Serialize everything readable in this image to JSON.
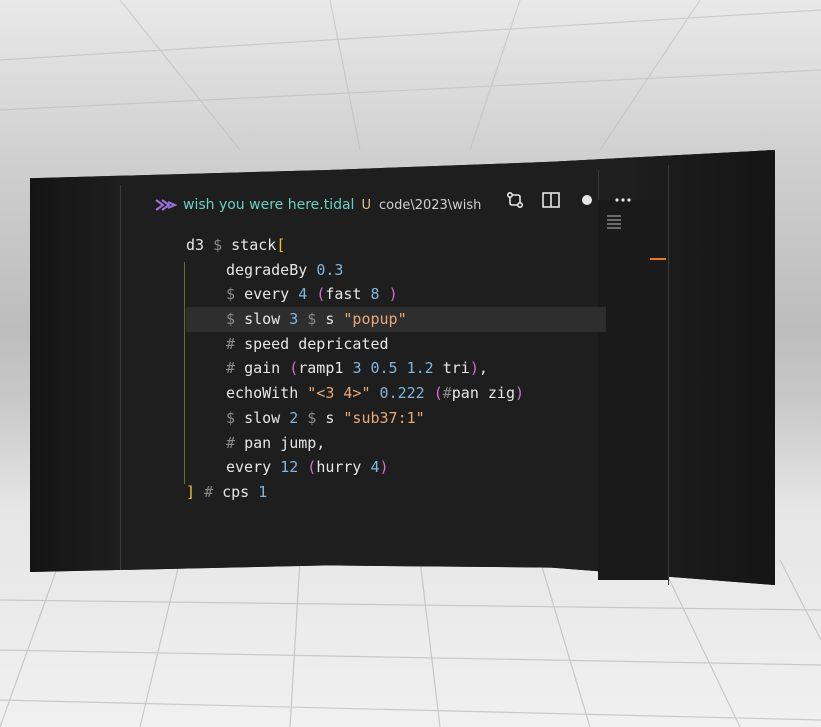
{
  "editor": {
    "tab": {
      "filename": "wish you were here.tidal",
      "status": "U",
      "path": "code\\2023\\wish",
      "icon": "tidal-file-icon"
    },
    "actions": [
      "source-control-icon",
      "split-editor-icon",
      "dot-icon",
      "more-icon"
    ],
    "code_lines": [
      {
        "parts": [
          [
            "kw",
            "d3 "
          ],
          [
            "op",
            "$ "
          ],
          [
            "kw",
            "stack"
          ],
          [
            "br1",
            "["
          ]
        ]
      },
      {
        "parts": [
          [
            "ind",
            ""
          ],
          [
            "kw",
            "degradeBy "
          ],
          [
            "num",
            "0.3"
          ]
        ]
      },
      {
        "parts": [
          [
            "ind",
            ""
          ],
          [
            "op",
            "$ "
          ],
          [
            "kw",
            "every "
          ],
          [
            "num",
            "4 "
          ],
          [
            "br2",
            "("
          ],
          [
            "kw",
            "fast "
          ],
          [
            "num",
            "8 "
          ],
          [
            "br2",
            ")"
          ]
        ]
      },
      {
        "parts": [
          [
            "ind",
            ""
          ],
          [
            "op",
            "$ "
          ],
          [
            "kw",
            "slow "
          ],
          [
            "num",
            "3 "
          ],
          [
            "op",
            "$ "
          ],
          [
            "kw",
            "s "
          ],
          [
            "str",
            "\"popup\""
          ]
        ],
        "highlight": true
      },
      {
        "parts": [
          [
            "ind",
            ""
          ],
          [
            "op",
            "# "
          ],
          [
            "kw",
            "speed depricated"
          ]
        ]
      },
      {
        "parts": [
          [
            "ind",
            ""
          ],
          [
            "op",
            "# "
          ],
          [
            "kw",
            "gain "
          ],
          [
            "br2",
            "("
          ],
          [
            "kw",
            "ramp1 "
          ],
          [
            "num",
            "3 0.5 1.2 "
          ],
          [
            "kw",
            "tri"
          ],
          [
            "br2",
            ")"
          ],
          [
            "kw",
            ","
          ]
        ]
      },
      {
        "parts": [
          [
            "ind",
            ""
          ],
          [
            "kw",
            "echoWith "
          ],
          [
            "str",
            "\"<3 4>\" "
          ],
          [
            "num",
            "0.222 "
          ],
          [
            "br2",
            "("
          ],
          [
            "op",
            "#"
          ],
          [
            "kw",
            "pan zig"
          ],
          [
            "br2",
            ")"
          ]
        ]
      },
      {
        "parts": [
          [
            "ind",
            ""
          ],
          [
            "op",
            "$ "
          ],
          [
            "kw",
            "slow "
          ],
          [
            "num",
            "2 "
          ],
          [
            "op",
            "$ "
          ],
          [
            "kw",
            "s "
          ],
          [
            "str",
            "\"sub37:1\""
          ]
        ]
      },
      {
        "parts": [
          [
            "ind",
            ""
          ],
          [
            "op",
            "# "
          ],
          [
            "kw",
            "pan jump,"
          ]
        ]
      },
      {
        "parts": [
          [
            "ind",
            ""
          ],
          [
            "kw",
            "every "
          ],
          [
            "num",
            "12 "
          ],
          [
            "br2",
            "("
          ],
          [
            "kw",
            "hurry "
          ],
          [
            "num",
            "4"
          ],
          [
            "br2",
            ")"
          ]
        ]
      },
      {
        "parts": [
          [
            "br1",
            "] "
          ],
          [
            "op",
            "# "
          ],
          [
            "kw",
            "cps "
          ],
          [
            "num",
            "1"
          ]
        ]
      }
    ],
    "colors": {
      "filename": "#6ad0c2",
      "modified": "#e2c08d",
      "number": "#7fb6e0",
      "string": "#e8a878",
      "bracket_outer": "#f2c12e",
      "bracket_inner": "#d06fd0",
      "scroll_marker": "#e07a1a"
    }
  }
}
